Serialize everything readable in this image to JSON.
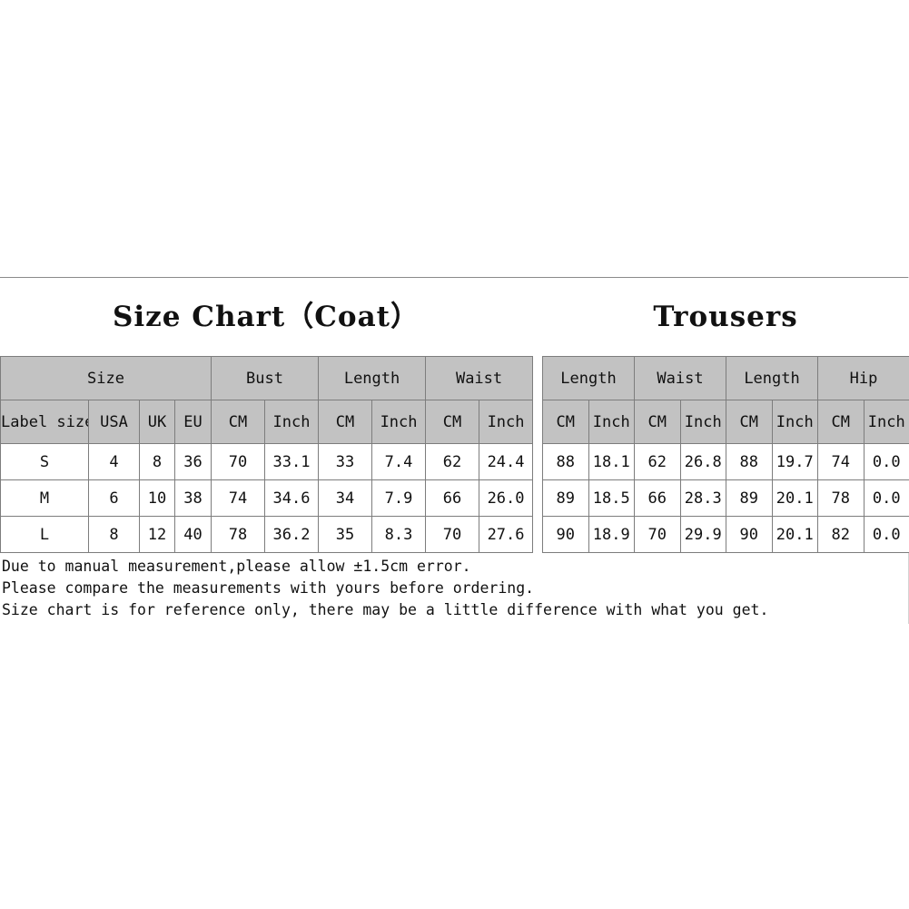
{
  "coat": {
    "title": "Size Chart（Coat）",
    "group_headers": [
      "Size",
      "Bust",
      "Length",
      "Waist"
    ],
    "sub_headers": [
      "Label size",
      "USA",
      "UK",
      "EU",
      "CM",
      "Inch",
      "CM",
      "Inch",
      "CM",
      "Inch"
    ],
    "rows": [
      [
        "S",
        "4",
        "8",
        "36",
        "70",
        "33.1",
        "33",
        "7.4",
        "62",
        "24.4"
      ],
      [
        "M",
        "6",
        "10",
        "38",
        "74",
        "34.6",
        "34",
        "7.9",
        "66",
        "26.0"
      ],
      [
        "L",
        "8",
        "12",
        "40",
        "78",
        "36.2",
        "35",
        "8.3",
        "70",
        "27.6"
      ]
    ]
  },
  "trousers": {
    "title": "Trousers",
    "group_headers": [
      "Length",
      "Waist",
      "Length",
      "Hip"
    ],
    "sub_headers": [
      "CM",
      "Inch",
      "CM",
      "Inch",
      "CM",
      "Inch",
      "CM",
      "Inch"
    ],
    "rows": [
      [
        "88",
        "18.1",
        "62",
        "26.8",
        "88",
        "19.7",
        "74",
        "0.0"
      ],
      [
        "89",
        "18.5",
        "66",
        "28.3",
        "89",
        "20.1",
        "78",
        "0.0"
      ],
      [
        "90",
        "18.9",
        "70",
        "29.9",
        "90",
        "20.1",
        "82",
        "0.0"
      ]
    ]
  },
  "notes": [
    "Due to manual measurement,please allow ±1.5cm error.",
    "Please compare the measurements with yours before ordering.",
    "Size chart is for reference only, there may be a little difference with what you get."
  ],
  "colors": {
    "header_gray": "#c2c2c2",
    "border_gray": "#7d7d7d",
    "text": "#111111",
    "background": "#ffffff"
  }
}
